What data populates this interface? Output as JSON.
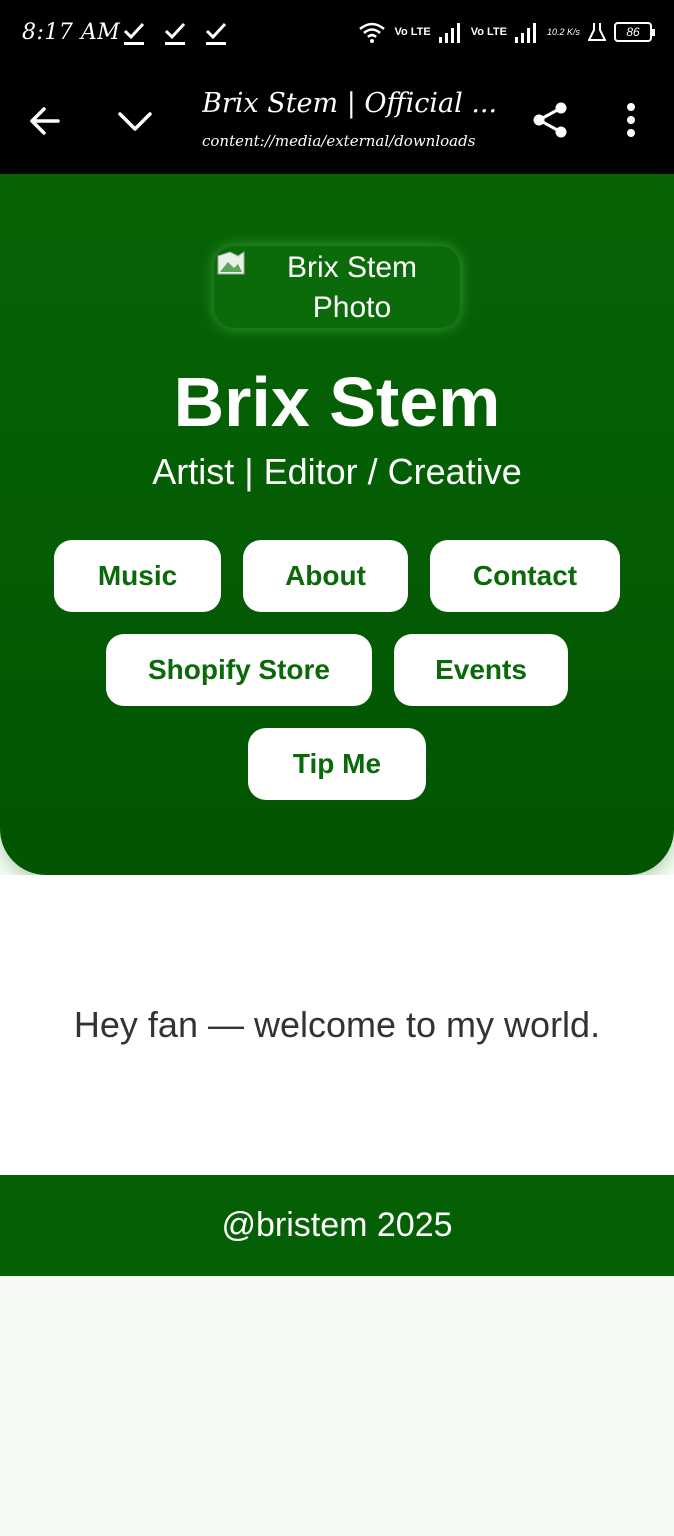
{
  "status_bar": {
    "time": "8:17 AM",
    "network_label_1": "Vo LTE",
    "network_label_2": "Vo LTE",
    "speed": "10.2 K/s",
    "battery": "86"
  },
  "app_bar": {
    "title": "Brix Stem | Official ...",
    "url": "content://media/external/downloads"
  },
  "hero": {
    "photo_alt": "Brix Stem Photo",
    "name": "Brix Stem",
    "tagline": "Artist | Editor / Creative",
    "buttons": [
      "Music",
      "About",
      "Contact",
      "Shopify Store",
      "Events",
      "Tip Me"
    ]
  },
  "main": {
    "welcome": "Hey fan — welcome to my world."
  },
  "footer": {
    "text": "@bristem 2025"
  },
  "colors": {
    "primary_green": "#056005",
    "button_text": "#0a6a0a",
    "page_bg": "#f4fbf3"
  }
}
